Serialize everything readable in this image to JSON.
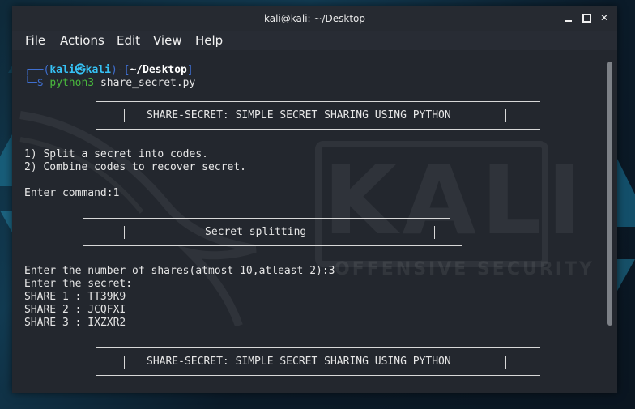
{
  "window": {
    "title": "kali@kali: ~/Desktop"
  },
  "menu": [
    "File",
    "Actions",
    "Edit",
    "View",
    "Help"
  ],
  "watermark": {
    "brand": "KALI",
    "tagline": "OFFENSIVE SECURITY"
  },
  "prompt": {
    "open": "┌──(",
    "user": "kali",
    "at": "㉿",
    "host": "kali",
    "mid": ")-[",
    "path": "~/Desktop",
    "close": "]",
    "corner": "└─",
    "dollar": "$",
    "cmd": "python3",
    "arg": "share_secret.py"
  },
  "banner": "SHARE-SECRET: SIMPLE SECRET SHARING USING PYTHON",
  "options": [
    "1) Split a secret into codes.",
    "2) Combine codes to recover secret."
  ],
  "enter_command": "Enter command:1",
  "section_title": "Secret splitting",
  "prompts": {
    "shares": "Enter the number of shares(atmost 10,atleast 2):3",
    "secret": "Enter the secret:"
  },
  "shares": [
    "SHARE 1 : TT39K9",
    "SHARE 2 : JCQFXI",
    "SHARE 3 : IXZXR2"
  ],
  "colors": {
    "prompt_blue": "#3f6fd0",
    "user_cyan": "#36c2f5",
    "dollar_green": "#49b83d"
  }
}
